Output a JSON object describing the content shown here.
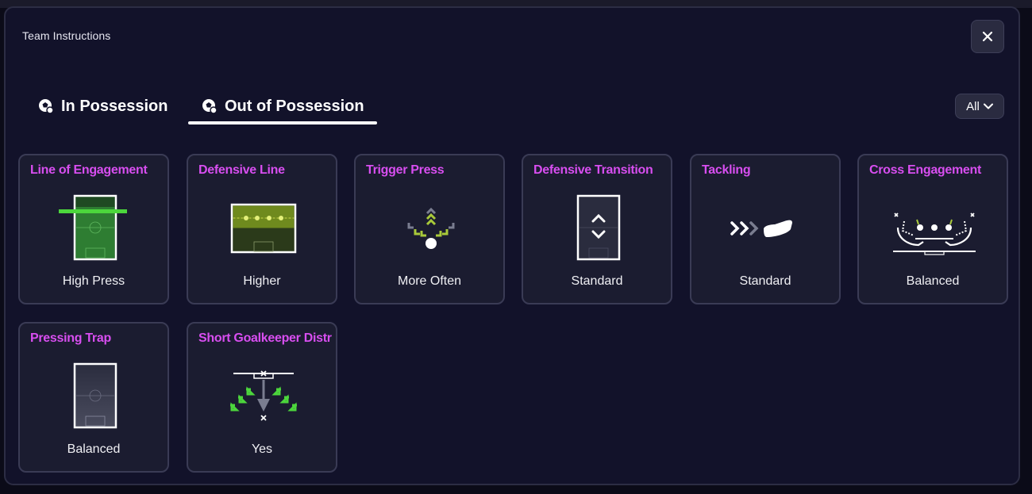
{
  "modal": {
    "title": "Team Instructions"
  },
  "tabs": [
    {
      "label": "In Possession",
      "icon": "football-icon",
      "active": false
    },
    {
      "label": "Out of Possession",
      "icon": "football-icon",
      "active": true
    }
  ],
  "filter": {
    "label": "All"
  },
  "colors": {
    "title_accent": "#d84ef0",
    "pitch_green": "#3a8a3a",
    "arrow_lime": "#a8c93a",
    "line_green": "#4cd63c"
  },
  "cards": [
    {
      "title": "Line of Engagement",
      "value": "High Press",
      "icon": "line-of-engagement-icon"
    },
    {
      "title": "Defensive Line",
      "value": "Higher",
      "icon": "defensive-line-icon"
    },
    {
      "title": "Trigger Press",
      "value": "More Often",
      "icon": "trigger-press-icon"
    },
    {
      "title": "Defensive Transition",
      "value": "Standard",
      "icon": "defensive-transition-icon"
    },
    {
      "title": "Tackling",
      "value": "Standard",
      "icon": "tackling-icon"
    },
    {
      "title": "Cross Engagement",
      "value": "Balanced",
      "icon": "cross-engagement-icon"
    },
    {
      "title": "Pressing Trap",
      "value": "Balanced",
      "icon": "pressing-trap-icon"
    },
    {
      "title": "Short Goalkeeper Distr",
      "value": "Yes",
      "icon": "goalkeeper-distribution-icon"
    }
  ]
}
